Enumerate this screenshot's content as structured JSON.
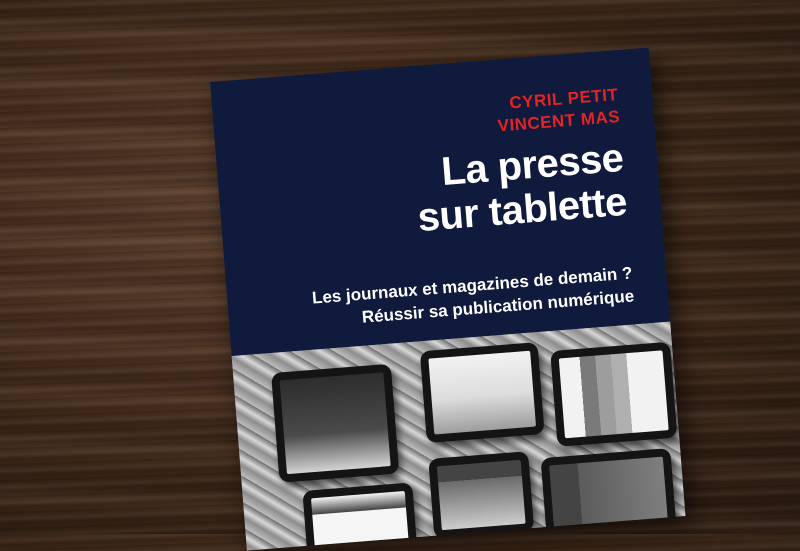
{
  "book": {
    "authors": [
      "CYRIL PETIT",
      "VINCENT MAS"
    ],
    "title_lines": [
      "La presse",
      "sur tablette"
    ],
    "subtitle_lines": [
      "Les journaux et magazines de demain ?",
      "Réussir sa publication numérique"
    ]
  },
  "colors": {
    "cover_navy": "#0f1a3d",
    "author_red": "#e32424",
    "title_white": "#ffffff",
    "wood_dark": "#3d2718"
  }
}
